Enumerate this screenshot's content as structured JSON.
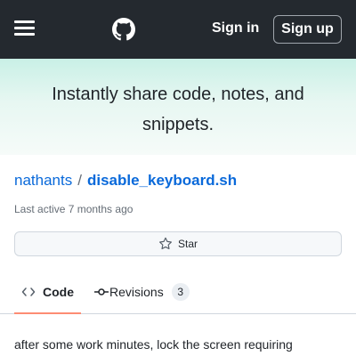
{
  "header": {
    "menu_icon": "hamburger-icon",
    "logo_icon": "github-logo-icon",
    "sign_in_label": "Sign in",
    "sign_up_label": "Sign up",
    "background_color": "#24292f"
  },
  "banner": {
    "text": "Instantly share code, notes, and snippets."
  },
  "gist": {
    "owner": "nathants",
    "separator": "/",
    "name": "disable_keyboard.sh",
    "last_active": "Last active 7 months ago",
    "star_label": "Star",
    "star_icon": "star-outline-icon",
    "description": "after some work minutes, lock the screen requiring"
  },
  "tabs": [
    {
      "label": "Code",
      "icon": "code-icon",
      "selected": true
    },
    {
      "label": "Revisions",
      "icon": "git-commit-icon",
      "count": "3",
      "selected": false
    }
  ],
  "colors": {
    "link": "#0969da",
    "active_tab_underline": "#fd8c73"
  }
}
